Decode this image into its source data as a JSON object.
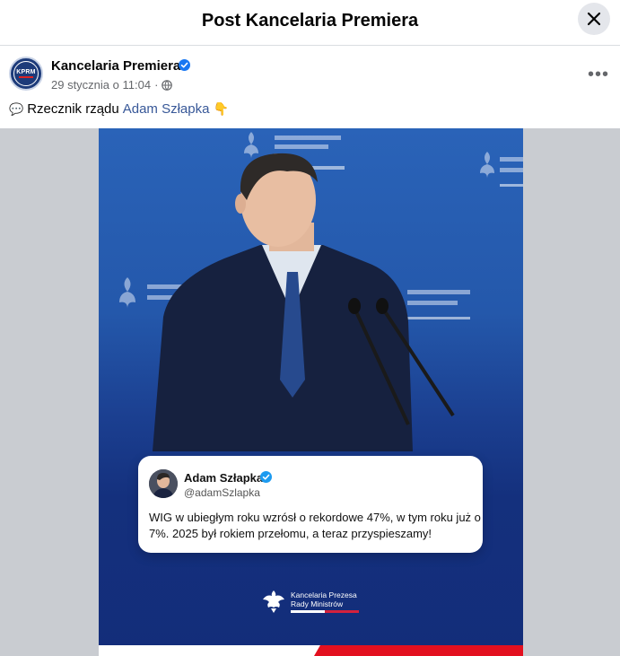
{
  "modal": {
    "title": "Post Kancelaria Premiera"
  },
  "post": {
    "author": "Kancelaria Premiera",
    "avatar_text": "KPRM",
    "date": "29 stycznia o 11:04",
    "meta_sep": "·",
    "text_prefix": "Rzecznik rządu",
    "link": "Adam Szłapka",
    "emoji_start": "💬",
    "emoji_end": "👇",
    "more_label": "•••"
  },
  "graphic": {
    "tweet_name": "Adam Szłapka",
    "tweet_handle": "@adamSzlapka",
    "tweet_text": "WIG w ubiegłym roku wzrósł o rekordowe 47%, w tym roku już o 7%. 2025 był rokiem przełomu, a teraz przyspieszamy!",
    "footer_line1": "Kancelaria Prezesa",
    "footer_line2": "Rady Ministrów",
    "bg_text_line1": "Kancelaria Prezesa",
    "bg_text_line2": "Rady Ministrów"
  },
  "colors": {
    "link": "#385898",
    "verified": "#1877f2",
    "accent_red": "#e3101f",
    "graphic_blue": "#1b3f90"
  },
  "icons": {
    "close": "close-icon",
    "verified": "verified-badge-icon",
    "globe": "globe-icon",
    "more": "more-options-icon"
  }
}
